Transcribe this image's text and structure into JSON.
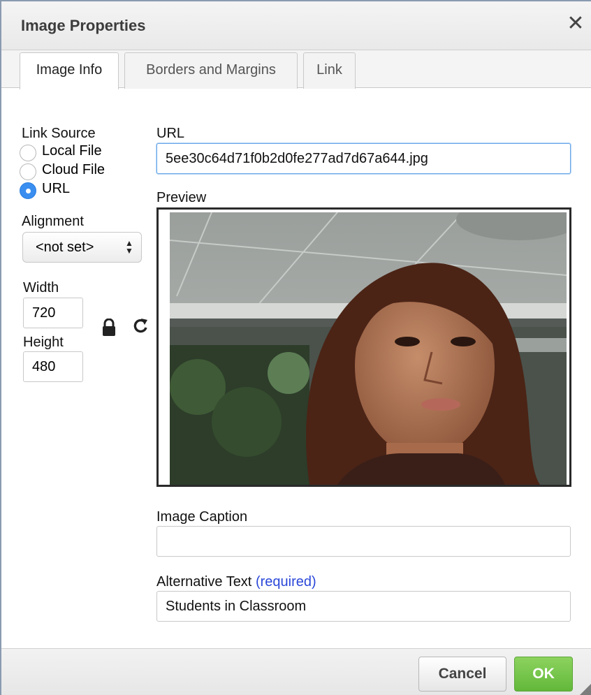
{
  "dialog": {
    "title": "Image Properties",
    "close_icon": "close-icon"
  },
  "tabs": [
    {
      "label": "Image Info",
      "active": true
    },
    {
      "label": "Borders and Margins",
      "active": false
    },
    {
      "label": "Link",
      "active": false
    }
  ],
  "link_source": {
    "label": "Link Source",
    "options": [
      {
        "label": "Local File",
        "checked": false
      },
      {
        "label": "Cloud File",
        "checked": false
      },
      {
        "label": "URL",
        "checked": true
      }
    ]
  },
  "alignment": {
    "label": "Alignment",
    "value": "<not set>"
  },
  "dimensions": {
    "width_label": "Width",
    "width_value": "720",
    "height_label": "Height",
    "height_value": "480",
    "lock_icon": "lock-icon",
    "reset_icon": "reset-icon"
  },
  "url": {
    "label": "URL",
    "value": "5ee30c64d71f0b2d0fe277ad7d67a644.jpg"
  },
  "preview": {
    "label": "Preview"
  },
  "caption": {
    "label": "Image Caption",
    "value": ""
  },
  "alt_text": {
    "label": "Alternative Text",
    "required": "(required)",
    "value": "Students in Classroom"
  },
  "footer": {
    "cancel_label": "Cancel",
    "ok_label": "OK"
  },
  "colors": {
    "accent": "#3a8ef0",
    "ok_button": "#6dbd45",
    "required_link": "#2b48d9"
  }
}
